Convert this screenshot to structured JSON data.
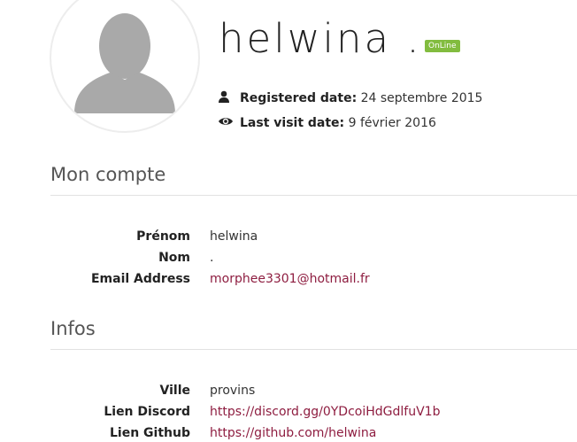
{
  "profile": {
    "username": "helwina .",
    "status_badge": "OnLine",
    "registered_label": "Registered date:",
    "registered_value": "24 septembre 2015",
    "last_visit_label": "Last visit date:",
    "last_visit_value": "9 février 2016",
    "user_icon": "user-icon",
    "eye_icon": "eye-icon"
  },
  "account": {
    "title": "Mon compte",
    "rows": [
      {
        "label": "Prénom",
        "value": "helwina"
      },
      {
        "label": "Nom",
        "value": "."
      },
      {
        "label": "Email Address",
        "value": "morphee3301@hotmail.fr"
      }
    ]
  },
  "infos": {
    "title": "Infos",
    "rows": [
      {
        "label": "Ville",
        "value": "provins"
      },
      {
        "label": "Lien Discord",
        "value": "https://discord.gg/0YDcoiHdGdlfuV1b"
      },
      {
        "label": "Lien Github",
        "value": "https://github.com/helwina"
      }
    ]
  },
  "colors": {
    "badge": "#82bc3f",
    "link": "#8e1d40",
    "avatar_silhouette": "#a9a9a9"
  }
}
